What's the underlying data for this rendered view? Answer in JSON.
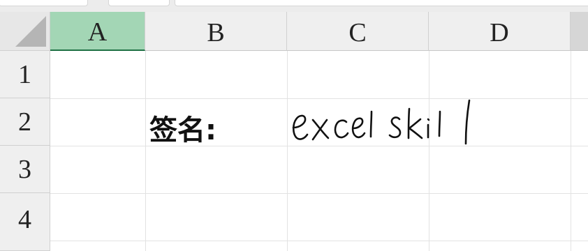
{
  "columns": [
    "A",
    "B",
    "C",
    "D"
  ],
  "rows": [
    "1",
    "2",
    "3",
    "4"
  ],
  "selected_column": "A",
  "cells": {
    "B2": "签名:",
    "C2": "excel skill"
  },
  "colors": {
    "selected_header": "#a3d6b5",
    "selected_underline": "#1e7145",
    "header_bg": "#efefef",
    "gridline": "#e2e2e2"
  }
}
